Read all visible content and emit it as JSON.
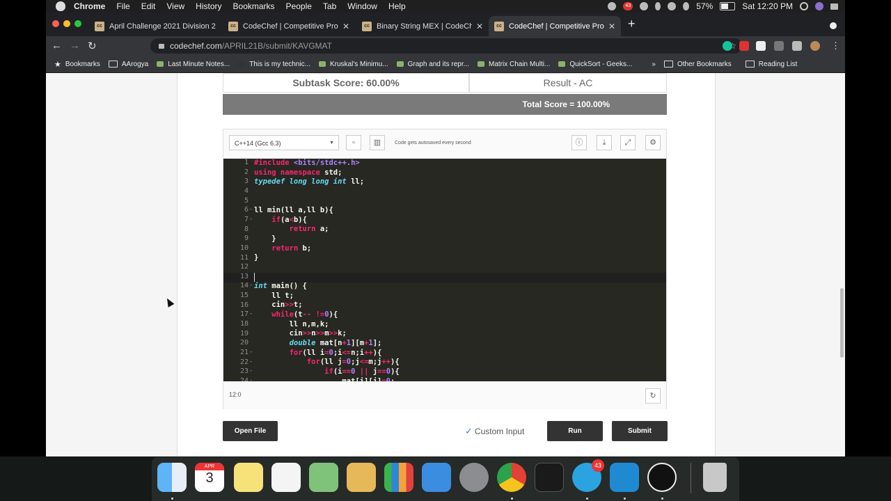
{
  "menubar": {
    "app": "Chrome",
    "items": [
      "File",
      "Edit",
      "View",
      "History",
      "Bookmarks",
      "People",
      "Tab",
      "Window",
      "Help"
    ],
    "notification_badge": "43",
    "battery": "57%",
    "clock": "Sat 12:20 PM"
  },
  "tabs": [
    {
      "favicon": "cc",
      "title": "April Challenge 2021 Division 2"
    },
    {
      "favicon": "cc",
      "title": "CodeChef | Competitive Progr"
    },
    {
      "favicon": "cc",
      "title": "Binary String MEX | CodeChef"
    },
    {
      "favicon": "cc",
      "title": "CodeChef | Competitive Progr"
    }
  ],
  "new_tab": "+",
  "url": {
    "host": "codechef.com",
    "path": "/APRIL21B/submit/KAVGMAT"
  },
  "bookmarks": {
    "items": [
      "Bookmarks",
      "AArogya",
      "Last Minute Notes...",
      "This is my technic...",
      "Kruskal's Minimu...",
      "Graph and its repr...",
      "Matrix Chain Multi...",
      "QuickSort - Geeks..."
    ],
    "overflow": "»",
    "other": "Other Bookmarks",
    "reading": "Reading List"
  },
  "result": {
    "subtask_score": "Subtask Score: 60.00%",
    "result_label": "Result - AC",
    "total_score": "Total Score = 100.00%"
  },
  "editor": {
    "language": "C++14 (Gcc 6.3)",
    "autosave": "Code gets autosaved every second",
    "cursor_position": "12:0",
    "line_numbers": [
      "1",
      "2",
      "3",
      "4",
      "5",
      "6",
      "7",
      "8",
      "9",
      "10",
      "11",
      "12",
      "13",
      "14",
      "15",
      "16",
      "17",
      "18",
      "19",
      "20",
      "21",
      "22",
      "23",
      "24"
    ],
    "fold_marker": "-"
  },
  "buttons": {
    "open_file": "Open File",
    "custom_input": "Custom Input",
    "run": "Run",
    "submit": "Submit"
  },
  "dock": {
    "calendar_month": "APR",
    "calendar_day": "3",
    "telegram_badge": "43"
  }
}
